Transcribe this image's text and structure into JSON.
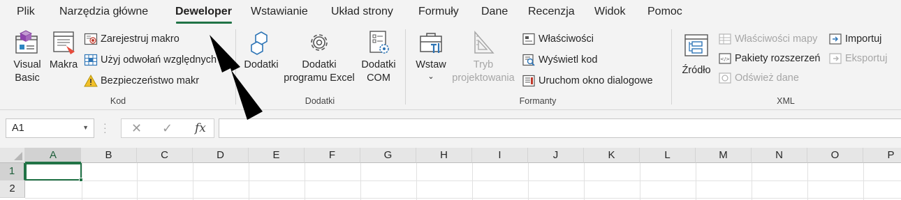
{
  "tabs": [
    "Plik",
    "Narzędzia główne",
    "Deweloper",
    "Wstawianie",
    "Układ strony",
    "Formuły",
    "Dane",
    "Recenzja",
    "Widok",
    "Pomoc"
  ],
  "active_tab": "Deweloper",
  "ribbon": {
    "groups": {
      "kod": {
        "label": "Kod",
        "visual_basic": [
          "Visual",
          "Basic"
        ],
        "makra": "Makra",
        "zarejestruj_makro": "Zarejestruj makro",
        "uzyj_odwolan": "Użyj odwołań względnych",
        "bezpieczenstwo": "Bezpieczeństwo makr"
      },
      "dodatki": {
        "label": "Dodatki",
        "dodatki": "Dodatki",
        "dodatki_excel": [
          "Dodatki",
          "programu Excel"
        ],
        "dodatki_com": [
          "Dodatki",
          "COM"
        ]
      },
      "formanty": {
        "label": "Formanty",
        "wstaw": "Wstaw",
        "tryb_projektowania": [
          "Tryb",
          "projektowania"
        ],
        "wlasciwosci": "Właściwości",
        "wyswietl_kod": "Wyświetl kod",
        "uruchom_okno": "Uruchom okno dialogowe"
      },
      "xml": {
        "label": "XML",
        "zrodlo": "Źródło",
        "wlasciwosci_mapy": "Właściwości mapy",
        "pakiety_rozszerzen": "Pakiety rozszerzeń",
        "odswiez_dane": "Odśwież dane",
        "importuj": "Importuj",
        "eksportuj": "Eksportuj"
      }
    }
  },
  "formula_bar": {
    "name_box": "A1",
    "fx": "fx",
    "cancel_icon": "✕",
    "enter_icon": "✓",
    "formula": ""
  },
  "grid": {
    "columns": [
      "A",
      "B",
      "C",
      "D",
      "E",
      "F",
      "G",
      "H",
      "I",
      "J",
      "K",
      "L",
      "M",
      "N",
      "O",
      "P"
    ],
    "rows": [
      "1",
      "2"
    ],
    "active_cell": "A1"
  },
  "colors": {
    "accent": "#217346",
    "ribbon_bg": "#f3f3f3"
  }
}
